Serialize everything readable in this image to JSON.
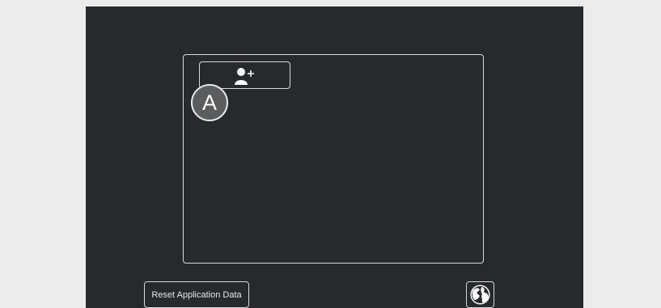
{
  "panel": {
    "add_user_icon": "add-user-icon"
  },
  "callout": {
    "label": "A"
  },
  "footer": {
    "reset_label": "Reset Application Data",
    "globe_icon": "globe-icon"
  }
}
